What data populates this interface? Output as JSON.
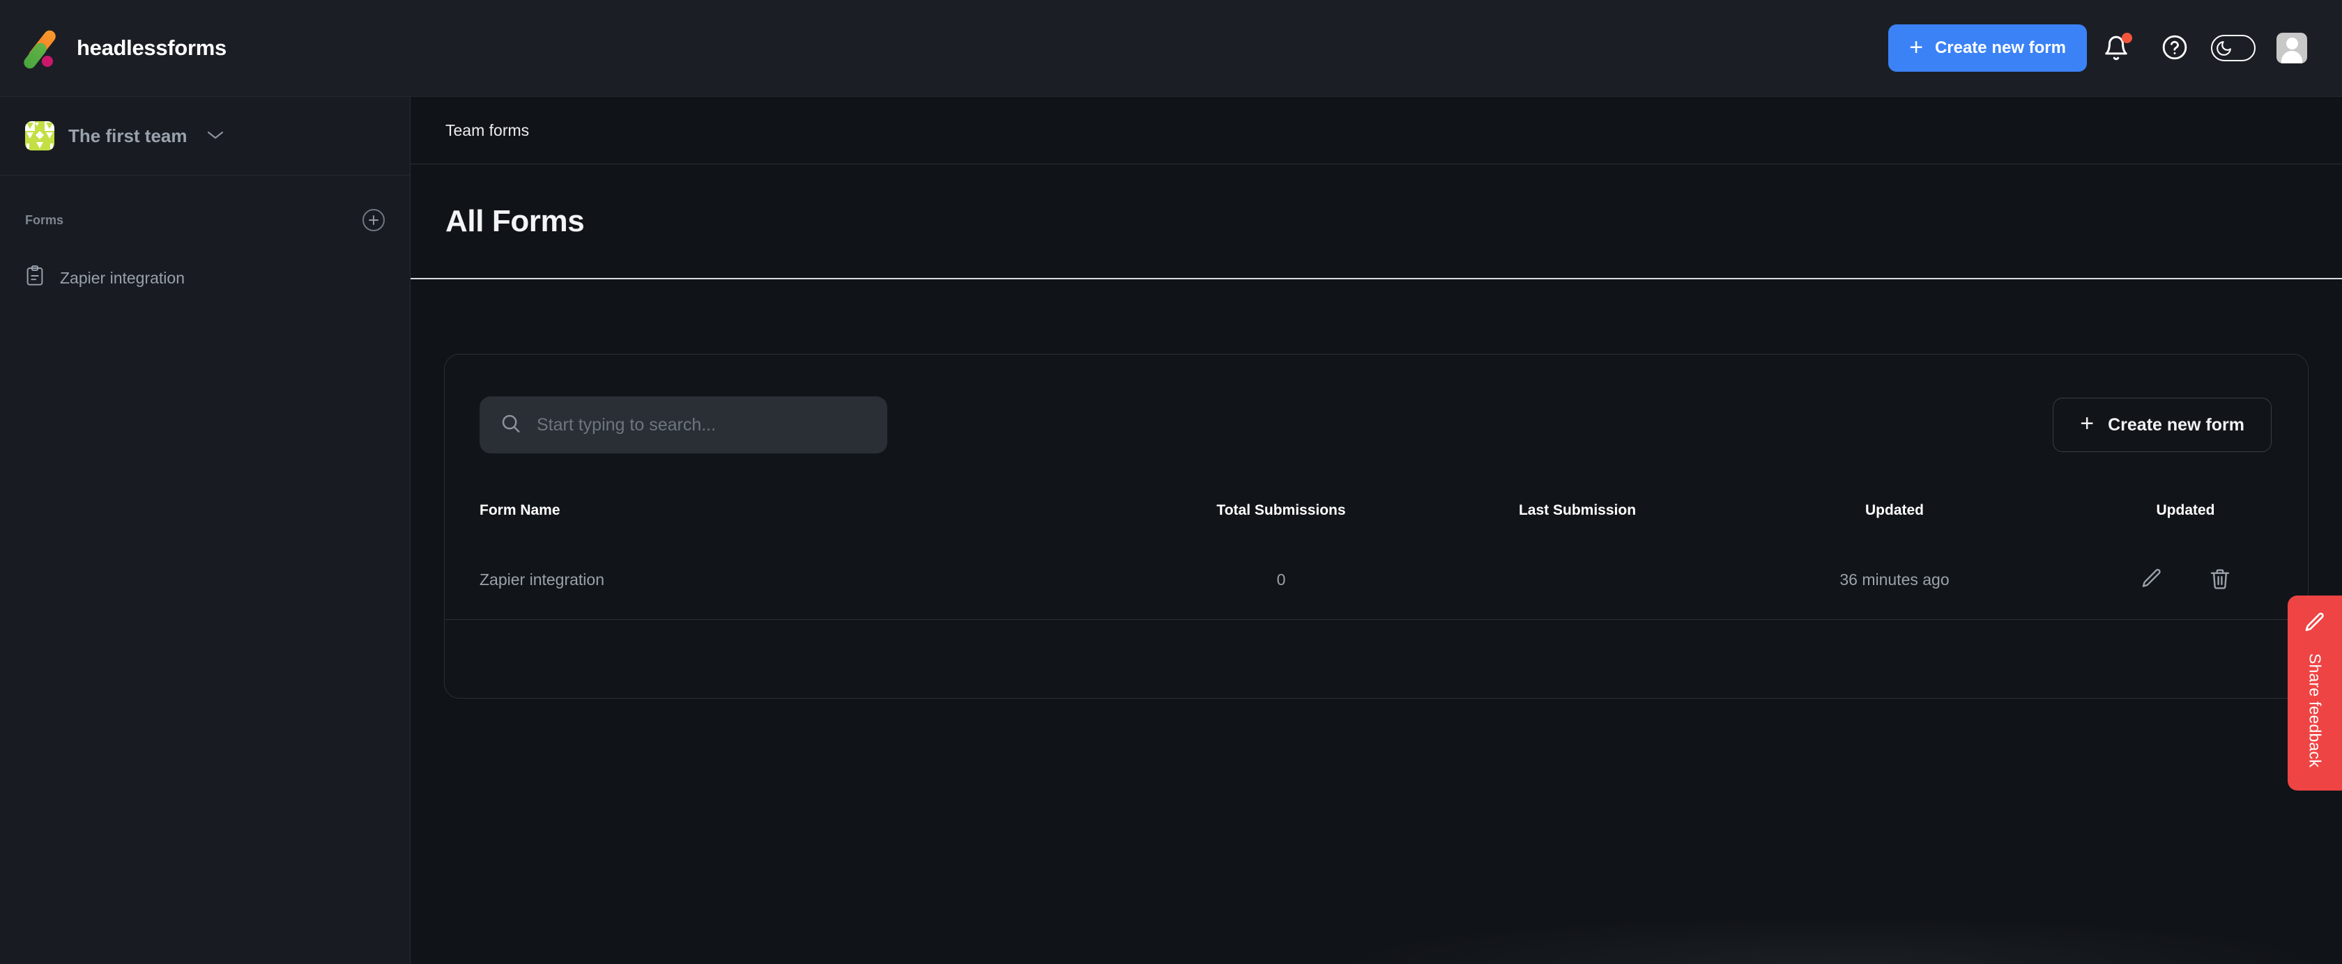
{
  "app": {
    "brand_name": "headlessforms",
    "logo_colors": {
      "orange": "#f3762a",
      "green": "#4aa53e",
      "magenta": "#c9186b"
    },
    "accent_color": "#3b82f6",
    "feedback_color": "#ef4444",
    "team_avatar_color": "#c3df43"
  },
  "topbar": {
    "create_button_label": "Create new form",
    "plus_glyph": "+",
    "icons": {
      "notifications": "bell-icon",
      "notification_badge": "unread-dot",
      "help": "help-circle-icon",
      "dark_mode": "moon-toggle-icon",
      "profile": "user-avatar-icon"
    }
  },
  "sidebar": {
    "team_name": "The first team",
    "team_chevron": "⌄",
    "section_title": "Forms",
    "add_form_glyph": "+",
    "items": [
      {
        "label": "Zapier integration",
        "icon": "clipboard-icon"
      }
    ]
  },
  "main": {
    "breadcrumb": "Team forms",
    "page_title": "All Forms",
    "search": {
      "placeholder": "Start typing to search...",
      "value": "",
      "icon": "search-icon"
    },
    "create_button_label": "Create new form",
    "table": {
      "headers": [
        "Form Name",
        "Total Submissions",
        "Last Submission",
        "Updated",
        "Updated"
      ],
      "rows": [
        {
          "form_name": "Zapier integration",
          "total_submissions": "0",
          "last_submission": "",
          "updated": "36 minutes ago",
          "actions": [
            "edit-icon",
            "delete-icon"
          ]
        }
      ]
    }
  },
  "feedback": {
    "label": "Share feedback",
    "icon": "pencil-icon"
  }
}
